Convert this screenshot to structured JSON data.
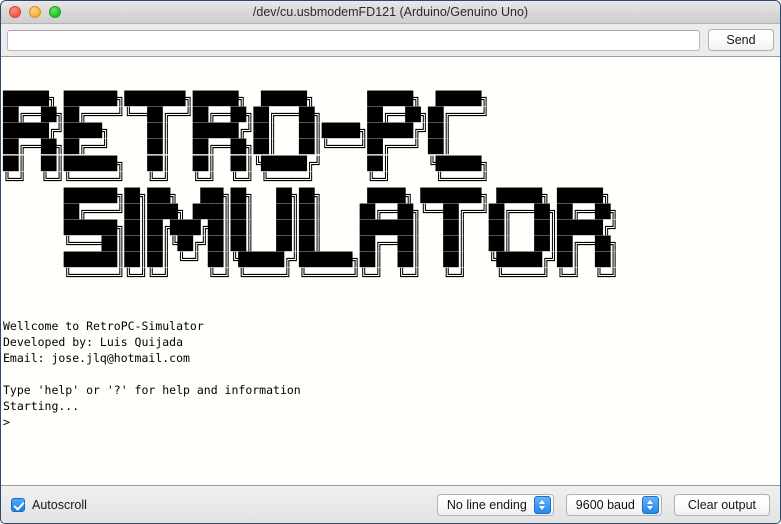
{
  "window": {
    "title": "/dev/cu.usbmodemFD121 (Arduino/Genuino Uno)",
    "traffic_lights": {
      "close_label": "close",
      "minimize_label": "minimize",
      "maximize_label": "maximize"
    }
  },
  "send_row": {
    "input_value": "",
    "input_placeholder": "",
    "send_label": "Send"
  },
  "console": {
    "banner_lines": [
      "██████╗ ███████╗████████╗██████╗  ██████╗       ██████╗  ██████╗",
      "██╔══██╗██╔════╝╚══██╔══╝██╔══██╗██╔═══██╗      ██╔══██╗██╔════╝",
      "██████╔╝█████╗     ██║   ██████╔╝██║   ██║█████╗██████╔╝██║     ",
      "██╔══██╗██╔══╝     ██║   ██╔══██╗██║   ██║╚════╝██╔═══╝ ██║     ",
      "██║  ██║███████╗   ██║   ██║  ██║╚██████╔╝      ██║     ╚██████╗",
      "╚═╝  ╚═╝╚══════╝   ╚═╝   ╚═╝  ╚═╝ ╚═════╝       ╚═╝      ╚═════╝",
      "        ███████╗██╗███╗   ███╗██╗   ██╗██╗      █████╗ ████████╗ ██████╗ ██████╗ ",
      "        ██╔════╝██║████╗ ████║██║   ██║██║     ██╔══██╗╚══██╔══╝██╔═══██╗██╔══██╗",
      "        ███████╗██║██╔████╔██║██║   ██║██║     ███████║   ██║   ██║   ██║██████╔╝",
      "        ╚════██║██║██║╚██╔╝██║██║   ██║██║     ██╔══██║   ██║   ██║   ██║██╔══██╗",
      "        ███████║██║██║ ╚═╝ ██║╚██████╔╝███████╗██║  ██║   ██║   ╚██████╔╝██║  ██║",
      "        ╚══════╝╚═╝╚═╝     ╚═╝ ╚═════╝ ╚══════╝╚═╝  ╚═╝   ╚═╝    ╚═════╝ ╚═╝  ╚═╝"
    ],
    "text_lines": [
      "Wellcome to RetroPC-Simulator",
      "Developed by: Luis Quijada",
      "Email: jose.jlq@hotmail.com",
      "",
      "Type 'help' or '?' for help and information",
      "Starting...",
      ">"
    ]
  },
  "bottom_bar": {
    "autoscroll_label": "Autoscroll",
    "autoscroll_checked": true,
    "line_ending_value": "No line ending",
    "baud_value": "9600 baud",
    "clear_label": "Clear output"
  },
  "colors": {
    "accent_blue": "#2487ea",
    "window_chrome": "#ececec",
    "console_bg": "#fffffb",
    "console_fg": "#000000"
  }
}
